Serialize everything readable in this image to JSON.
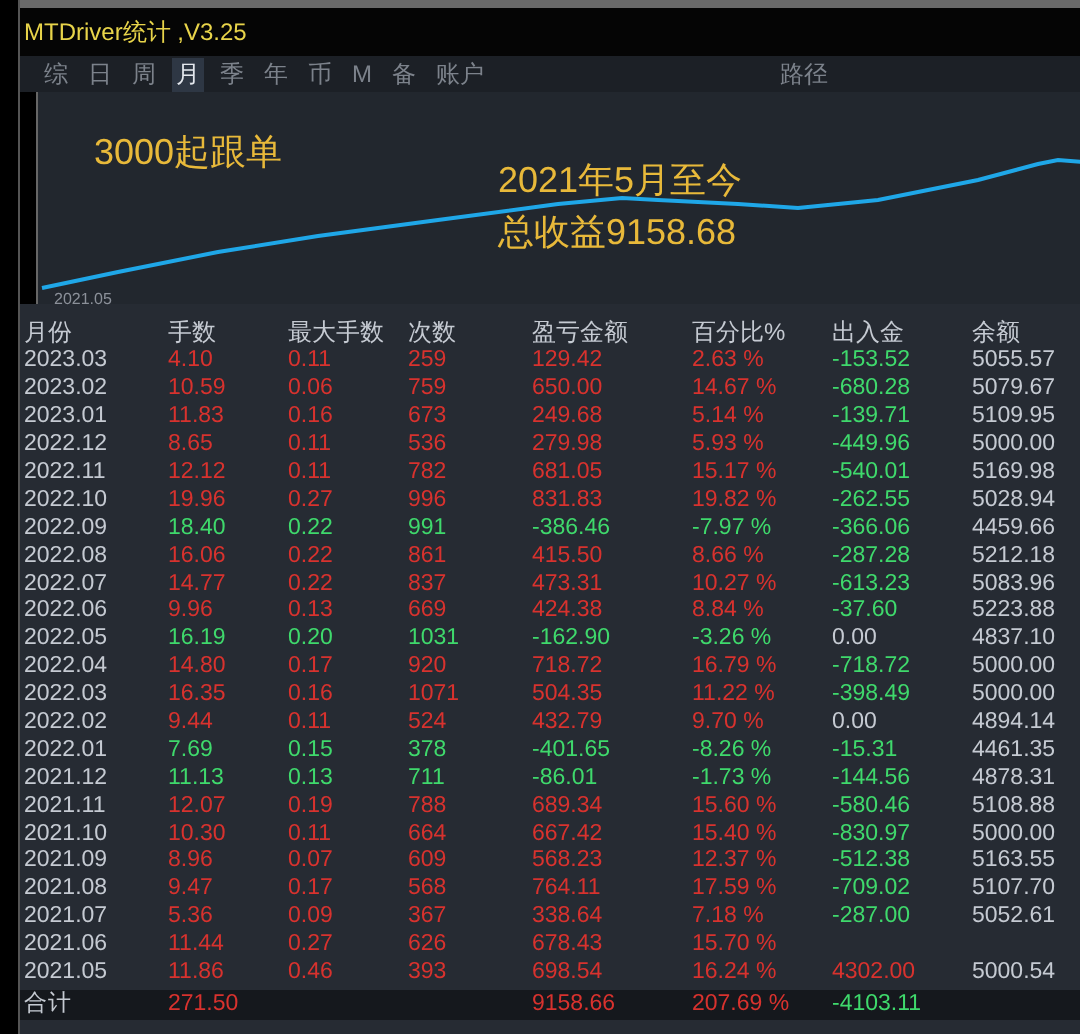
{
  "window": {
    "title": "MTDriver统计 ,V3.25"
  },
  "tabs": [
    {
      "label": "综",
      "selected": false
    },
    {
      "label": "日",
      "selected": false
    },
    {
      "label": "周",
      "selected": false
    },
    {
      "label": "月",
      "selected": true
    },
    {
      "label": "季",
      "selected": false
    },
    {
      "label": "年",
      "selected": false
    },
    {
      "label": "币",
      "selected": false
    },
    {
      "label": "M",
      "selected": false
    },
    {
      "label": "备",
      "selected": false
    },
    {
      "label": "账户",
      "selected": false
    }
  ],
  "path_tab": "路径",
  "chart": {
    "note": "3000起跟单",
    "caption_line_1": "2021年5月至今",
    "caption_line_2": "总收益9158.68",
    "start_label": "2021.05"
  },
  "table": {
    "columns": [
      "月份",
      "手数",
      "最大手数",
      "次数",
      "盈亏金额",
      "百分比%",
      "出入金",
      "余额"
    ],
    "rows": [
      {
        "month": "2023.03",
        "lots": "4.10",
        "max_lots": "0.11",
        "trades": "259",
        "pnl": "129.42",
        "percent": "2.63 %",
        "cash": {
          "text": "-153.52",
          "color": "#3fd96c"
        },
        "balance": "5055.57",
        "color": "#d8322e"
      },
      {
        "month": "2023.02",
        "lots": "10.59",
        "max_lots": "0.06",
        "trades": "759",
        "pnl": "650.00",
        "percent": "14.67 %",
        "cash": {
          "text": "-680.28",
          "color": "#3fd96c"
        },
        "balance": "5079.67",
        "color": "#d8322e"
      },
      {
        "month": "2023.01",
        "lots": "11.83",
        "max_lots": "0.16",
        "trades": "673",
        "pnl": "249.68",
        "percent": "5.14 %",
        "cash": {
          "text": "-139.71",
          "color": "#3fd96c"
        },
        "balance": "5109.95",
        "color": "#d8322e"
      },
      {
        "month": "2022.12",
        "lots": "8.65",
        "max_lots": "0.11",
        "trades": "536",
        "pnl": "279.98",
        "percent": "5.93 %",
        "cash": {
          "text": "-449.96",
          "color": "#3fd96c"
        },
        "balance": "5000.00",
        "color": "#d8322e"
      },
      {
        "month": "2022.11",
        "lots": "12.12",
        "max_lots": "0.11",
        "trades": "782",
        "pnl": "681.05",
        "percent": "15.17 %",
        "cash": {
          "text": "-540.01",
          "color": "#3fd96c"
        },
        "balance": "5169.98",
        "color": "#d8322e"
      },
      {
        "month": "2022.10",
        "lots": "19.96",
        "max_lots": "0.27",
        "trades": "996",
        "pnl": "831.83",
        "percent": "19.82 %",
        "cash": {
          "text": "-262.55",
          "color": "#3fd96c"
        },
        "balance": "5028.94",
        "color": "#d8322e"
      },
      {
        "month": "2022.09",
        "lots": "18.40",
        "max_lots": "0.22",
        "trades": "991",
        "pnl": "-386.46",
        "percent": "-7.97 %",
        "cash": {
          "text": "-366.06",
          "color": "#3fd96c"
        },
        "balance": "4459.66",
        "color": "#3fd96c"
      },
      {
        "month": "2022.08",
        "lots": "16.06",
        "max_lots": "0.22",
        "trades": "861",
        "pnl": "415.50",
        "percent": "8.66 %",
        "cash": {
          "text": "-287.28",
          "color": "#3fd96c"
        },
        "balance": "5212.18",
        "color": "#d8322e"
      },
      {
        "month": "2022.07",
        "lots": "14.77",
        "max_lots": "0.22",
        "trades": "837",
        "pnl": "473.31",
        "percent": "10.27 %",
        "cash": {
          "text": "-613.23",
          "color": "#3fd96c"
        },
        "balance": "5083.96",
        "color": "#d8322e"
      },
      {
        "month": "2022.06",
        "lots": "9.96",
        "max_lots": "0.13",
        "trades": "669",
        "pnl": "424.38",
        "percent": "8.84 %",
        "cash": {
          "text": "-37.60",
          "color": "#3fd96c"
        },
        "balance": "5223.88",
        "color": "#d8322e"
      },
      {
        "month": "2022.05",
        "lots": "16.19",
        "max_lots": "0.20",
        "trades": "1031",
        "pnl": "-162.90",
        "percent": "-3.26 %",
        "cash": {
          "text": "0.00",
          "color": "#c5cad2"
        },
        "balance": "4837.10",
        "color": "#3fd96c"
      },
      {
        "month": "2022.04",
        "lots": "14.80",
        "max_lots": "0.17",
        "trades": "920",
        "pnl": "718.72",
        "percent": "16.79 %",
        "cash": {
          "text": "-718.72",
          "color": "#3fd96c"
        },
        "balance": "5000.00",
        "color": "#d8322e"
      },
      {
        "month": "2022.03",
        "lots": "16.35",
        "max_lots": "0.16",
        "trades": "1071",
        "pnl": "504.35",
        "percent": "11.22 %",
        "cash": {
          "text": "-398.49",
          "color": "#3fd96c"
        },
        "balance": "5000.00",
        "color": "#d8322e"
      },
      {
        "month": "2022.02",
        "lots": "9.44",
        "max_lots": "0.11",
        "trades": "524",
        "pnl": "432.79",
        "percent": "9.70 %",
        "cash": {
          "text": "0.00",
          "color": "#c5cad2"
        },
        "balance": "4894.14",
        "color": "#d8322e"
      },
      {
        "month": "2022.01",
        "lots": "7.69",
        "max_lots": "0.15",
        "trades": "378",
        "pnl": "-401.65",
        "percent": "-8.26 %",
        "cash": {
          "text": "-15.31",
          "color": "#3fd96c"
        },
        "balance": "4461.35",
        "color": "#3fd96c"
      },
      {
        "month": "2021.12",
        "lots": "11.13",
        "max_lots": "0.13",
        "trades": "711",
        "pnl": "-86.01",
        "percent": "-1.73 %",
        "cash": {
          "text": "-144.56",
          "color": "#3fd96c"
        },
        "balance": "4878.31",
        "color": "#3fd96c"
      },
      {
        "month": "2021.11",
        "lots": "12.07",
        "max_lots": "0.19",
        "trades": "788",
        "pnl": "689.34",
        "percent": "15.60 %",
        "cash": {
          "text": "-580.46",
          "color": "#3fd96c"
        },
        "balance": "5108.88",
        "color": "#d8322e"
      },
      {
        "month": "2021.10",
        "lots": "10.30",
        "max_lots": "0.11",
        "trades": "664",
        "pnl": "667.42",
        "percent": "15.40 %",
        "cash": {
          "text": "-830.97",
          "color": "#3fd96c"
        },
        "balance": "5000.00",
        "color": "#d8322e"
      },
      {
        "month": "2021.09",
        "lots": "8.96",
        "max_lots": "0.07",
        "trades": "609",
        "pnl": "568.23",
        "percent": "12.37 %",
        "cash": {
          "text": "-512.38",
          "color": "#3fd96c"
        },
        "balance": "5163.55",
        "color": "#d8322e"
      },
      {
        "month": "2021.08",
        "lots": "9.47",
        "max_lots": "0.17",
        "trades": "568",
        "pnl": "764.11",
        "percent": "17.59 %",
        "cash": {
          "text": "-709.02",
          "color": "#3fd96c"
        },
        "balance": "5107.70",
        "color": "#d8322e"
      },
      {
        "month": "2021.07",
        "lots": "5.36",
        "max_lots": "0.09",
        "trades": "367",
        "pnl": "338.64",
        "percent": "7.18 %",
        "cash": {
          "text": "-287.00",
          "color": "#3fd96c"
        },
        "balance": "5052.61",
        "color": "#d8322e"
      },
      {
        "month": "2021.06",
        "lots": "11.44",
        "max_lots": "0.27",
        "trades": "626",
        "pnl": "678.43",
        "percent": "15.70 %",
        "color": "#d8322e"
      },
      {
        "month": "2021.05",
        "lots": "11.86",
        "max_lots": "0.46",
        "trades": "393",
        "pnl": "698.54",
        "percent": "16.24 %",
        "cash": {
          "text": "4302.00",
          "color": "#d8322e"
        },
        "balance": "5000.54",
        "color": "#d8322e"
      }
    ],
    "total": {
      "label": "合计",
      "lots": "271.50",
      "pnl": "9158.66",
      "percent": "207.69 %",
      "cash": "-4103.11"
    }
  }
}
